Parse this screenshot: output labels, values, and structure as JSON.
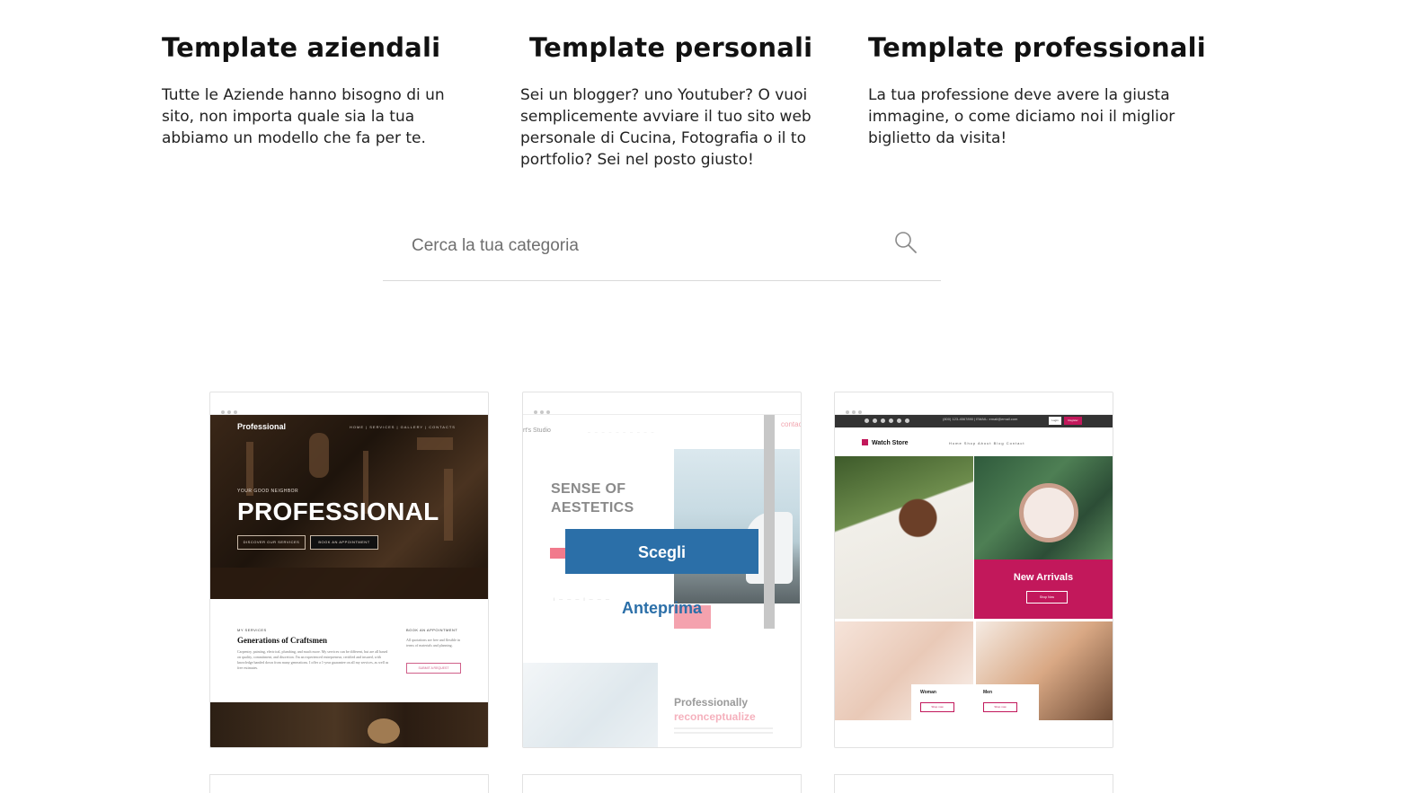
{
  "categories": [
    {
      "title": "Template aziendali",
      "description": "Tutte le Aziende hanno bisogno di un sito, non importa quale sia la tua abbiamo un modello che fa per te."
    },
    {
      "title": "Template personali",
      "description": "Sei un blogger? uno Youtuber? O vuoi semplicemente avviare il tuo sito web personale di Cucina, Fotografia o il to portfolio? Sei nel posto giusto!"
    },
    {
      "title": "Template professionali",
      "description": "La tua professione deve avere la giusta immagine, o come diciamo noi il miglior biglietto da visita!"
    }
  ],
  "search": {
    "placeholder": "Cerca la tua categoria",
    "icon": "search-icon"
  },
  "templates": [
    {
      "brand": "Professional",
      "nav": "HOME  |  SERVICES  |  GALLERY  |  CONTACTS",
      "eyebrow": "YOUR GOOD NEIGHBOR",
      "hero": "PROFESSIONAL",
      "btn1": "DISCOVER OUR SERVICES",
      "btn2": "BOOK AN APPOINTMENT",
      "section_label": "MY SERVICES",
      "section_title": "Generations of Craftsmen",
      "section_text": "Carpentry, painting, electrical, plumbing, and much more. My services can be different, but are all based on quality, commitment, and discretion. I'm an experienced entrepreneur, certified and insured, with knowledge handed down from many generations. I offer a 1-year guarantee on all my services, as well as free estimates.",
      "side_label": "BOOK AN APPOINTMENT",
      "side_text": "All quotations are free and flexible in terms of materials and planning.",
      "side_button": "SUBMIT A REQUEST"
    },
    {
      "logo": "rt's Studio",
      "top_right": "contac",
      "heading_line1": "SENSE OF",
      "heading_line2": "AESTETICS",
      "heading2_line1": "Professionally",
      "heading2_line2": "reconceptualize",
      "choose_label": "Scegli",
      "preview_label": "Anteprima"
    },
    {
      "top_text": "(800) 123-4567890  |  EMAIL: email@email.com",
      "login": "Login",
      "register": "Register",
      "brand": "Watch Store",
      "nav": "Home     Shop     About     Blog     Contact",
      "promo_title": "New Arrivals",
      "promo_button": "Shop Now",
      "woman_label": "Woman",
      "men_label": "Men",
      "shop_now": "Shop now"
    }
  ]
}
